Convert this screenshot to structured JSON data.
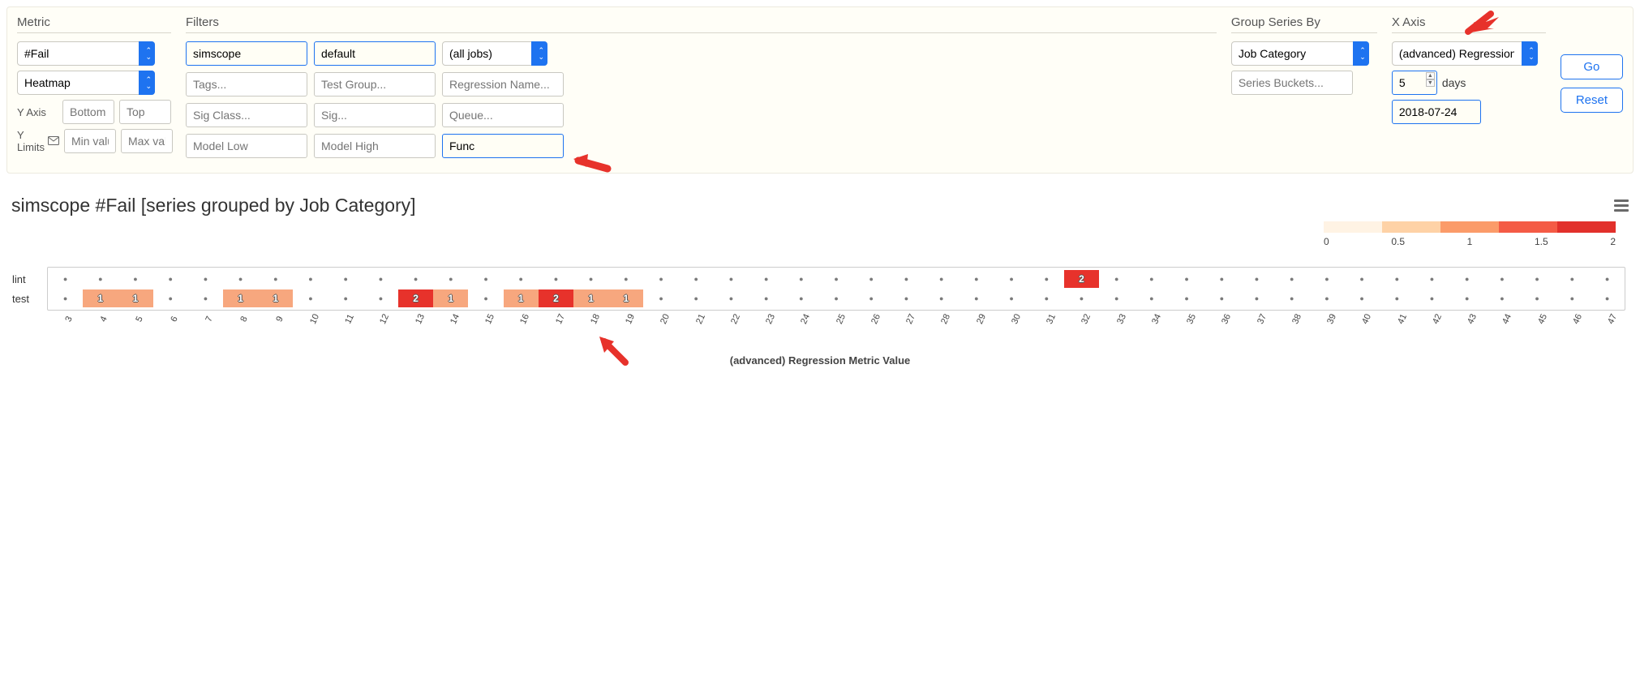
{
  "metric": {
    "title": "Metric",
    "metric_select": "#Fail",
    "chart_type_select": "Heatmap",
    "yaxis_label": "Y Axis",
    "yaxis_bottom_ph": "Bottom",
    "yaxis_top_ph": "Top",
    "ylimits_label": "Y Limits",
    "ylimits_min_ph": "Min value",
    "ylimits_max_ph": "Max value"
  },
  "filters": {
    "title": "Filters",
    "f_simscope": "simscope",
    "f_default": "default",
    "f_jobs_select": "(all jobs)",
    "ph_tags": "Tags...",
    "ph_testgroup": "Test Group...",
    "ph_regname": "Regression Name...",
    "ph_sigclass": "Sig Class...",
    "ph_sig": "Sig...",
    "ph_queue": "Queue...",
    "ph_modellow": "Model Low",
    "ph_modelhigh": "Model High",
    "f_func": "Func"
  },
  "groupby": {
    "title": "Group Series By",
    "select": "Job Category",
    "ph_buckets": "Series Buckets..."
  },
  "xaxis": {
    "title": "X Axis",
    "select": "(advanced) Regression",
    "days_value": "5",
    "days_label": "days",
    "date_value": "2018-07-24"
  },
  "buttons": {
    "go": "Go",
    "reset": "Reset"
  },
  "chart_data": {
    "type": "heatmap",
    "title": "simscope #Fail [series grouped by Job Category]",
    "xlabel": "(advanced) Regression Metric Value",
    "x_ticks": [
      3,
      4,
      5,
      6,
      7,
      8,
      9,
      10,
      11,
      12,
      13,
      14,
      15,
      16,
      17,
      18,
      19,
      20,
      21,
      22,
      23,
      24,
      25,
      26,
      27,
      28,
      29,
      30,
      31,
      32,
      33,
      34,
      35,
      36,
      37,
      38,
      39,
      40,
      41,
      42,
      43,
      44,
      45,
      46,
      47
    ],
    "y_categories": [
      "lint",
      "test"
    ],
    "legend_ticks": [
      "0",
      "0.5",
      "1",
      "1.5",
      "2"
    ],
    "legend_colors": [
      "#fff3e4",
      "#fed2a6",
      "#fb9b69",
      "#f45b45",
      "#e2302b"
    ],
    "cells": {
      "lint": {
        "32": 2
      },
      "test": {
        "4": 1,
        "5": 1,
        "8": 1,
        "9": 1,
        "13": 2,
        "14": 1,
        "16": 1,
        "17": 2,
        "18": 1,
        "19": 1
      }
    }
  }
}
